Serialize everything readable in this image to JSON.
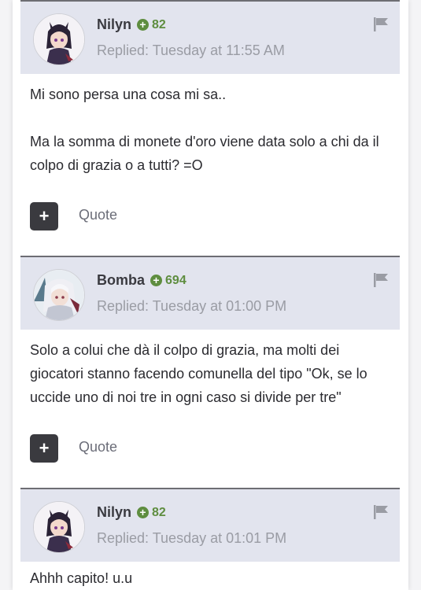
{
  "posts": [
    {
      "author": "Nilyn",
      "reputation": "82",
      "replied": "Replied: Tuesday at 11:55 AM",
      "body": [
        "Mi sono persa una cosa mi sa..",
        "Ma la somma di monete d'oro viene data solo a chi da il colpo di grazia o a tutti? =O"
      ],
      "avatar_icon": "anime-avatar-dark-hair",
      "quote_label": "Quote",
      "add_label": "+"
    },
    {
      "author": "Bomba",
      "reputation": "694",
      "replied": "Replied: Tuesday at 01:00 PM",
      "body": [
        "Solo a colui che dà il colpo di grazia, ma molti dei giocatori stanno facendo comunella del tipo \"Ok, se lo uccide uno di noi tre in ogni caso si divide per tre\""
      ],
      "avatar_icon": "anime-avatar-white-hair",
      "quote_label": "Quote",
      "add_label": "+"
    },
    {
      "author": "Nilyn",
      "reputation": "82",
      "replied": "Replied: Tuesday at 01:01 PM",
      "body": [
        "Ahhh capito! u.u"
      ],
      "avatar_icon": "anime-avatar-dark-hair"
    }
  ],
  "colors": {
    "header_bg": "#e2e4ee",
    "reputation_green": "#5e8d3f",
    "button_dark": "#3a3a3f"
  }
}
